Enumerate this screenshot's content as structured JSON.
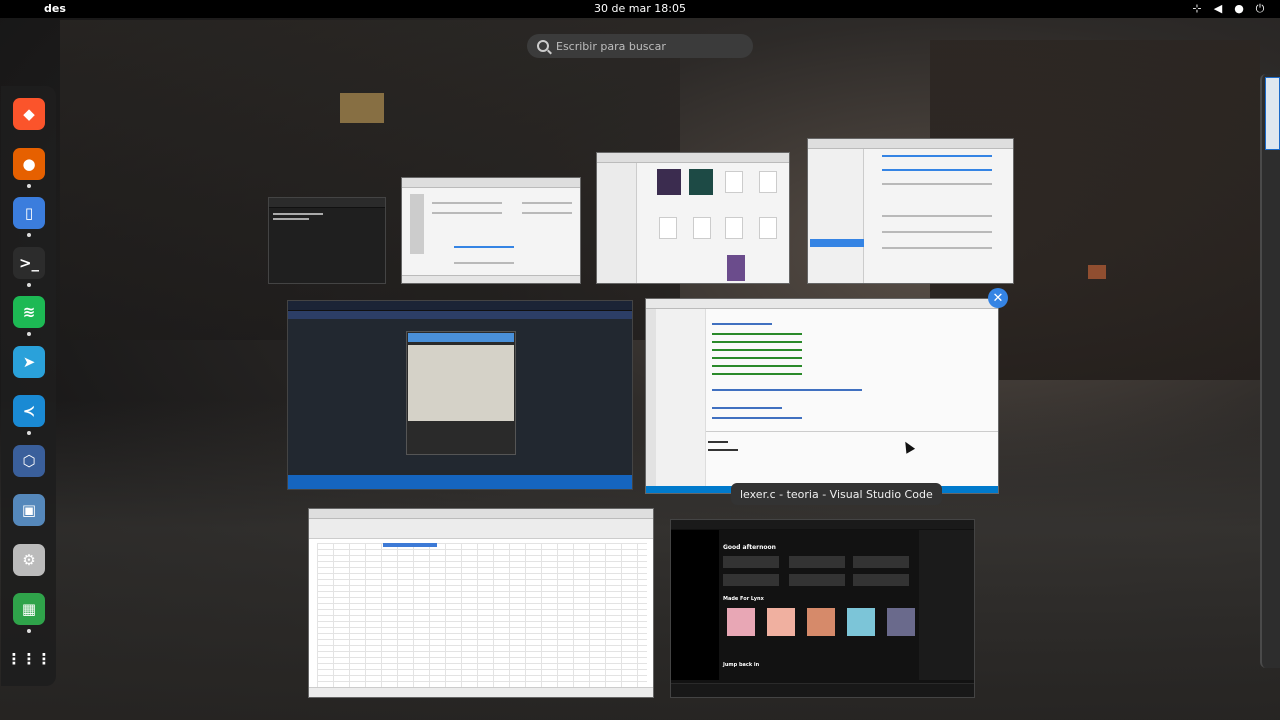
{
  "topbar": {
    "activities_label": "des",
    "clock": "30 de mar  18:05",
    "tray": [
      "network-icon",
      "volume-icon",
      "microphone-icon",
      "power-icon"
    ]
  },
  "search": {
    "placeholder": "Escribir para buscar"
  },
  "dock": {
    "items": [
      {
        "name": "brave-browser",
        "color": "#fb542b",
        "glyph": "◆",
        "running": false
      },
      {
        "name": "firefox",
        "color": "#e66000",
        "glyph": "●",
        "running": true
      },
      {
        "name": "files",
        "color": "#3b7ddd",
        "glyph": "▯",
        "running": true
      },
      {
        "name": "terminal",
        "color": "#2c2c2c",
        "glyph": ">_",
        "running": true
      },
      {
        "name": "spotify",
        "color": "#1db954",
        "glyph": "≋",
        "running": true
      },
      {
        "name": "telegram",
        "color": "#2aa1da",
        "glyph": "➤",
        "running": false
      },
      {
        "name": "visual-studio-code",
        "color": "#1a8ad4",
        "glyph": "≺",
        "running": true
      },
      {
        "name": "virtualbox",
        "color": "#3a5f9b",
        "glyph": "⬡",
        "running": false
      },
      {
        "name": "image-viewer",
        "color": "#5588bb",
        "glyph": "▣",
        "running": false
      },
      {
        "name": "settings",
        "color": "#bbbbbb",
        "glyph": "⚙",
        "running": false
      },
      {
        "name": "spreadsheet",
        "color": "#2fa34a",
        "glyph": "▦",
        "running": true
      },
      {
        "name": "show-apps",
        "color": "transparent",
        "glyph": "⋮⋮⋮",
        "running": false
      }
    ]
  },
  "windows": {
    "vscode_tooltip": "lexer.c - teoria - Visual Studio Code",
    "spotify_greeting": "Good afternoon",
    "spotify_section1": "Made For Lynx",
    "spotify_section2": "Jump back in"
  },
  "colors": {
    "accent": "#3584e4",
    "topbar": "#000000",
    "dock": "#1e1e1e"
  }
}
